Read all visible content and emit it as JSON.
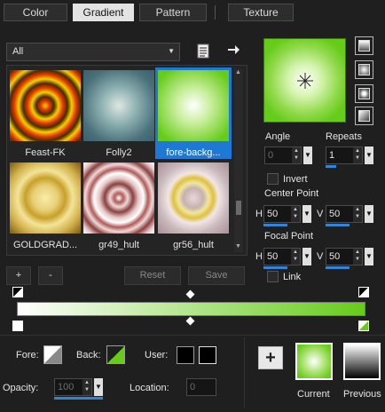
{
  "tabs": [
    {
      "label": "Color",
      "active": false
    },
    {
      "label": "Gradient",
      "active": true
    },
    {
      "label": "Pattern",
      "active": false
    },
    {
      "label": "Texture",
      "active": false
    }
  ],
  "category": {
    "selected": "All"
  },
  "gradients": [
    {
      "name": "Feast-FK",
      "selected": false
    },
    {
      "name": "Folly2",
      "selected": false
    },
    {
      "name": "fore-backg...",
      "selected": true
    },
    {
      "name": "GOLDGRAD...",
      "selected": false
    },
    {
      "name": "gr49_hult",
      "selected": false
    },
    {
      "name": "gr56_hult",
      "selected": false
    }
  ],
  "list_buttons": {
    "add": "+",
    "remove": "-",
    "reset": "Reset",
    "save": "Save"
  },
  "controls": {
    "angle_label": "Angle",
    "angle_value": "0",
    "repeats_label": "Repeats",
    "repeats_value": "1",
    "invert_label": "Invert",
    "center_point_label": "Center Point",
    "center_h_label": "H",
    "center_h": "50",
    "center_v_label": "V",
    "center_v": "50",
    "focal_point_label": "Focal Point",
    "focal_h_label": "H",
    "focal_h": "50",
    "focal_v_label": "V",
    "focal_v": "50",
    "link_label": "Link"
  },
  "bottom": {
    "fore_label": "Fore:",
    "back_label": "Back:",
    "user_label": "User:",
    "opacity_label": "Opacity:",
    "opacity_value": "100",
    "location_label": "Location:",
    "location_value": "0",
    "current_label": "Current",
    "previous_label": "Previous",
    "add_symbol": "+"
  },
  "colors": {
    "gradient_fore": "#ffffff",
    "gradient_back": "#66cc1a",
    "selection": "#1e78d6"
  },
  "icons": [
    "list-icon",
    "arrow-right-icon",
    "style-linear-icon",
    "style-radial-icon",
    "style-rect-icon",
    "style-sunburst-icon",
    "sunburst-center-icon"
  ]
}
